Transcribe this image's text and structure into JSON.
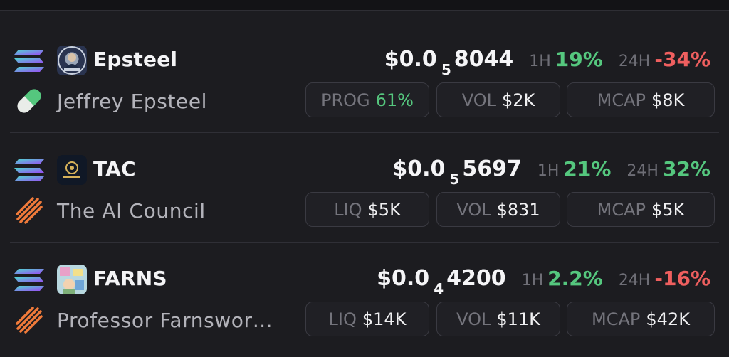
{
  "tokens": [
    {
      "ticker": "Epsteel",
      "name": "Jeffrey Epsteel",
      "chain_icon": "solana-icon",
      "launch_icon": "pill-icon",
      "price_prefix": "$0.0",
      "price_zeros": "5",
      "price_digits": "8044",
      "h1_label": "1H",
      "h1_value": "19%",
      "h24_label": "24H",
      "h24_value": "-34%",
      "stats": [
        {
          "key": "PROG",
          "value": "61%"
        },
        {
          "key": "VOL",
          "value": "$2K"
        },
        {
          "key": "MCAP",
          "value": "$8K"
        }
      ]
    },
    {
      "ticker": "TAC",
      "name": "The AI Council",
      "chain_icon": "solana-icon",
      "launch_icon": "launchpad-stripes-icon",
      "price_prefix": "$0.0",
      "price_zeros": "5",
      "price_digits": "5697",
      "h1_label": "1H",
      "h1_value": "21%",
      "h24_label": "24H",
      "h24_value": "32%",
      "stats": [
        {
          "key": "LIQ",
          "value": "$5K"
        },
        {
          "key": "VOL",
          "value": "$831"
        },
        {
          "key": "MCAP",
          "value": "$5K"
        }
      ]
    },
    {
      "ticker": "FARNS",
      "name": "Professor Farnswor…",
      "chain_icon": "solana-icon",
      "launch_icon": "launchpad-stripes-icon",
      "price_prefix": "$0.0",
      "price_zeros": "4",
      "price_digits": "4200",
      "h1_label": "1H",
      "h1_value": "2.2%",
      "h24_label": "24H",
      "h24_value": "-16%",
      "stats": [
        {
          "key": "LIQ",
          "value": "$14K"
        },
        {
          "key": "VOL",
          "value": "$11K"
        },
        {
          "key": "MCAP",
          "value": "$42K"
        }
      ]
    }
  ],
  "colors": {
    "background": "#1c1c20",
    "positive": "#55c77e",
    "negative": "#ef5f5f",
    "muted": "#74747c",
    "pill_border": "#3a3a42"
  }
}
